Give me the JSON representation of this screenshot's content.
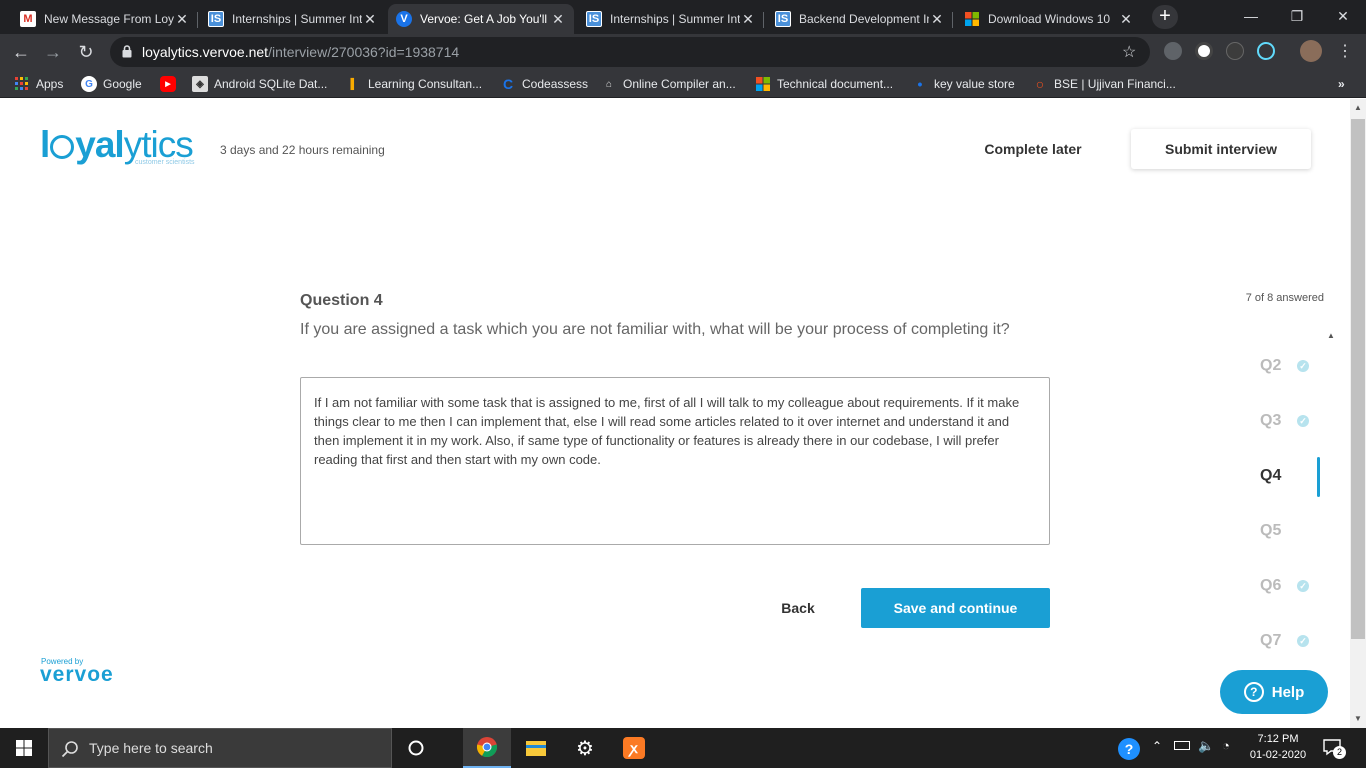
{
  "browser": {
    "tabs": [
      {
        "title": "New Message From Loyalytics",
        "favicon": "gmail-icon",
        "active": false
      },
      {
        "title": "Internships | Summer Internships",
        "favicon": "internshala-icon",
        "active": false
      },
      {
        "title": "Vervoe: Get A Job You'll Love",
        "favicon": "vervoe-icon",
        "active": true
      },
      {
        "title": "Internships | Summer Internships",
        "favicon": "internshala-icon",
        "active": false
      },
      {
        "title": "Backend Development Internship",
        "favicon": "internshala-icon",
        "active": false
      },
      {
        "title": "Download Windows 10",
        "favicon": "microsoft-icon",
        "active": false
      }
    ],
    "url": {
      "host": "loyalytics.vervoe.net",
      "path": "/interview/270036?id=1938714"
    },
    "bookmarks": [
      {
        "label": "Apps",
        "icon": "apps-grid-icon"
      },
      {
        "label": "Google",
        "icon": "google-icon"
      },
      {
        "label": "",
        "icon": "youtube-icon"
      },
      {
        "label": "Android SQLite Dat...",
        "icon": "android-icon"
      },
      {
        "label": "Learning Consultan...",
        "icon": "bookmark-page-icon"
      },
      {
        "label": "Codeassess",
        "icon": "codeassess-icon"
      },
      {
        "label": "Online Compiler an...",
        "icon": "compiler-icon"
      },
      {
        "label": "Technical document...",
        "icon": "microsoft-icon"
      },
      {
        "label": "key value store",
        "icon": "dot-icon"
      },
      {
        "label": "BSE | Ujjivan Financi...",
        "icon": "search-orange-icon"
      }
    ],
    "bookmarks_overflow": "»"
  },
  "header": {
    "logo_text_a": "l",
    "logo_text_b": "yal",
    "logo_text_c": "ytics",
    "logo_subtitle": "customer scientists",
    "remaining": "3 days and 22 hours remaining",
    "complete_later": "Complete later",
    "submit_interview": "Submit interview"
  },
  "question": {
    "number_label": "Question 4",
    "text": "If you are assigned a task which you are not familiar with, what will be your process of completing it?",
    "answered": "7 of 8 answered",
    "answer": "If I am not familiar with some task that is assigned to me, first of all I will talk to my colleague about requirements. If it make things clear to me then I can implement that, else I will read some articles related to it over internet and understand it and then implement it in my work. Also, if same type of functionality or features  is already there in our codebase, I will prefer reading that first and then start with my own code.",
    "back": "Back",
    "save": "Save and continue"
  },
  "question_nav": [
    {
      "label": "Q2",
      "answered": true,
      "current": false
    },
    {
      "label": "Q3",
      "answered": true,
      "current": false
    },
    {
      "label": "Q4",
      "answered": false,
      "current": true
    },
    {
      "label": "Q5",
      "answered": false,
      "current": false
    },
    {
      "label": "Q6",
      "answered": true,
      "current": false
    },
    {
      "label": "Q7",
      "answered": true,
      "current": false
    }
  ],
  "help": {
    "label": "Help"
  },
  "footer": {
    "powered_by": "Powered by",
    "brand": "vervoe"
  },
  "taskbar": {
    "search_placeholder": "Type here to search",
    "apps": [
      "cortana-icon",
      "chrome-icon",
      "file-explorer-icon",
      "settings-icon",
      "xampp-icon"
    ],
    "time": "7:12 PM",
    "date": "01-02-2020",
    "notifications": "2"
  },
  "colors": {
    "accent": "#1a9fd4",
    "answered_check": "#b7e3ee"
  }
}
